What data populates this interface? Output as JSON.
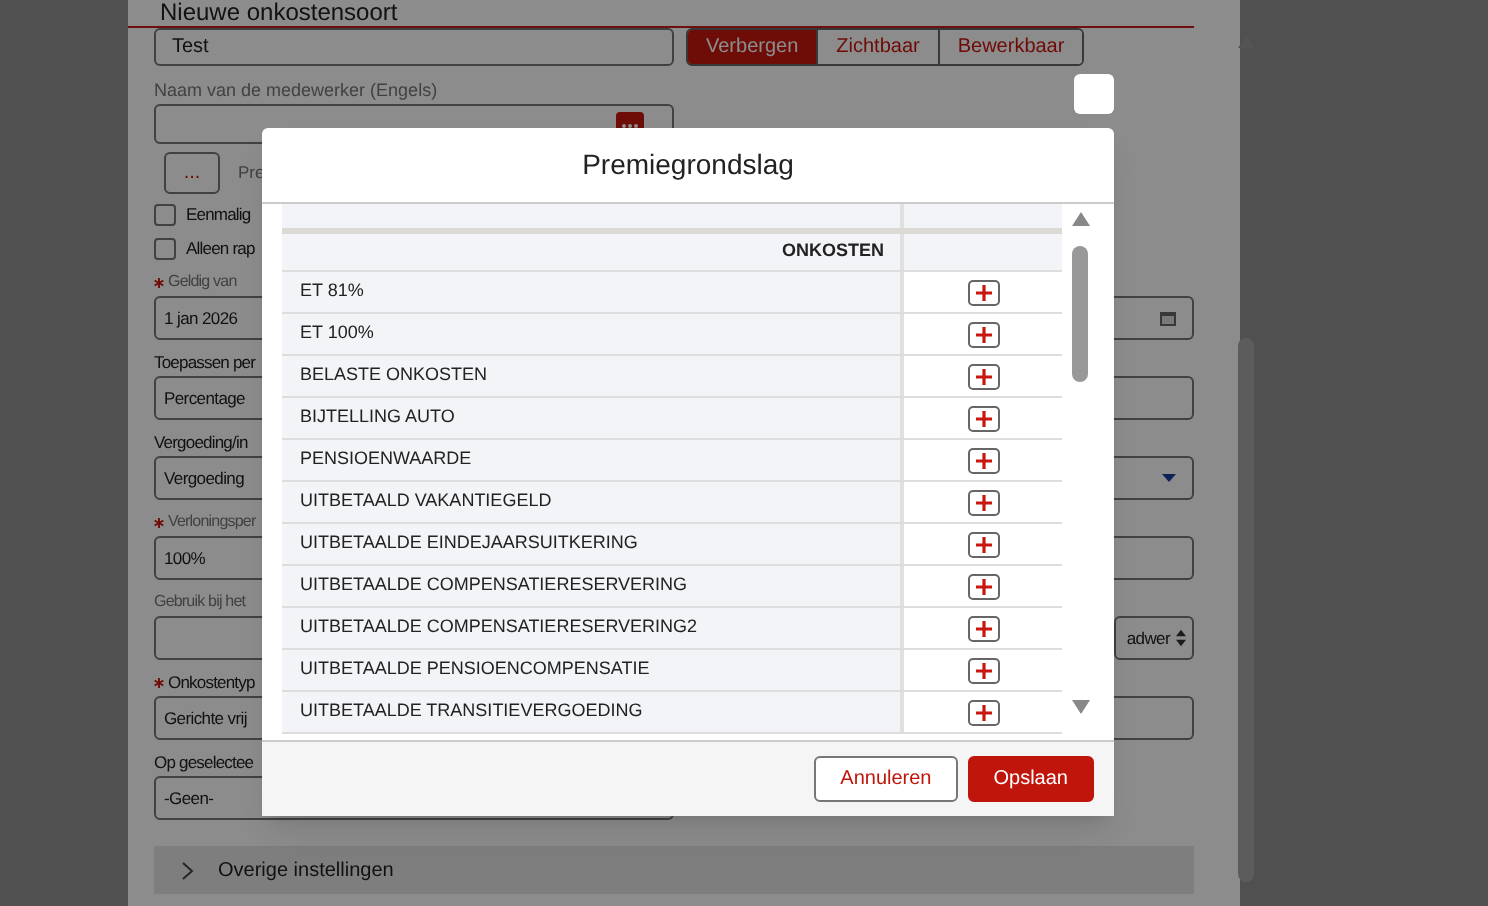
{
  "page": {
    "title": "Nieuwe onkostensoort"
  },
  "form": {
    "name_field": {
      "value": "Test"
    },
    "visibility": [
      {
        "label": "Verbergen",
        "selected": true
      },
      {
        "label": "Zichtbaar",
        "selected": false
      },
      {
        "label": "Bewerkbaar",
        "selected": false
      }
    ],
    "english_name": {
      "label": "Naam van de medewerker (Engels)"
    },
    "small_button": {
      "label": "...",
      "caption": "Pre"
    },
    "checkboxes": [
      {
        "label": "Eenmalig",
        "checked": false
      },
      {
        "label": "Alleen rap",
        "checked": false
      }
    ],
    "fields": [
      {
        "label": "Geldig van",
        "required": true,
        "muted": true,
        "kind": "date",
        "value": "1 jan 2026"
      },
      {
        "label": "Toepassen per",
        "required": false,
        "muted": false,
        "kind": "text",
        "value": "Percentage"
      },
      {
        "label": "Vergoeding/in",
        "required": false,
        "muted": false,
        "kind": "select",
        "value": "Vergoeding"
      },
      {
        "label": "Verloningsper",
        "required": true,
        "muted": true,
        "kind": "text",
        "value": "100%"
      },
      {
        "label": "Gebruik bij het",
        "required": false,
        "muted": true,
        "kind": "split",
        "value": "adwer"
      },
      {
        "label": "Onkostentyp",
        "required": true,
        "muted": false,
        "kind": "text",
        "value": "Gerichte vrij"
      },
      {
        "label": "Op geselectee",
        "required": false,
        "muted": false,
        "kind": "narrow_select",
        "value": "-Geen-"
      }
    ],
    "section": {
      "label": "Overige instellingen",
      "expanded": false
    }
  },
  "dialog": {
    "title": "Premiegrondslag",
    "column_header": "ONKOSTEN",
    "rows": [
      "ET 81%",
      "ET 100%",
      "BELASTE ONKOSTEN",
      "BIJTELLING AUTO",
      "PENSIOENWAARDE",
      "UITBETAALD VAKANTIEGELD",
      "UITBETAALDE EINDEJAARSUITKERING",
      "UITBETAALDE COMPENSATIERESERVERING",
      "UITBETAALDE COMPENSATIERESERVERING2",
      "UITBETAALDE PENSIOENCOMPENSATIE",
      "UITBETAALDE TRANSITIEVERGOEDING"
    ],
    "buttons": [
      {
        "label": "Annuleren",
        "kind": "secondary"
      },
      {
        "label": "Opslaan",
        "kind": "primary"
      }
    ]
  }
}
